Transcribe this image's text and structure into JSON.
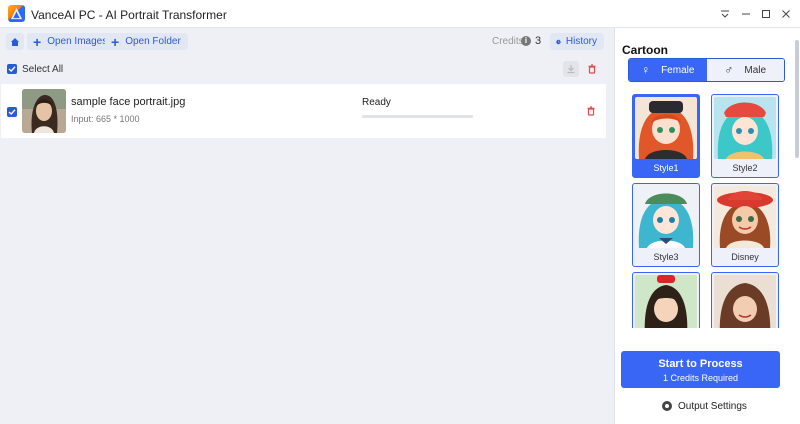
{
  "window": {
    "title": "VanceAI PC - AI Portrait Transformer",
    "controls": [
      "dropdown-menu-icon",
      "minimize-icon",
      "maximize-icon",
      "close-icon"
    ]
  },
  "toolbar": {
    "home_icon": "home-icon",
    "open_images_label": "Open Images",
    "open_folder_label": "Open Folder",
    "credits_label": "Credits",
    "credits_count": "3",
    "history_label": "History"
  },
  "list": {
    "select_all_label": "Select All",
    "select_all_checked": true,
    "files": [
      {
        "name": "sample face portrait.jpg",
        "meta": "Input: 665 * 1000",
        "status": "Ready",
        "progress": 0,
        "checked": true
      }
    ]
  },
  "panel": {
    "title": "Cartoon",
    "gender_options": [
      {
        "label": "Female",
        "symbol": "♀",
        "active": true
      },
      {
        "label": "Male",
        "symbol": "♂",
        "active": false
      }
    ],
    "styles": [
      {
        "label": "Style1",
        "selected": true
      },
      {
        "label": "Style2",
        "selected": false
      },
      {
        "label": "Style3",
        "selected": false
      },
      {
        "label": "Disney",
        "selected": false
      },
      {
        "label": "",
        "selected": false
      },
      {
        "label": "",
        "selected": false
      }
    ],
    "process_button": "Start to Process",
    "process_sub": "1 Credits Required",
    "output_settings": "Output Settings"
  },
  "colors": {
    "accent": "#3a66f5",
    "delete": "#e5484d",
    "background": "#eef0f6"
  }
}
